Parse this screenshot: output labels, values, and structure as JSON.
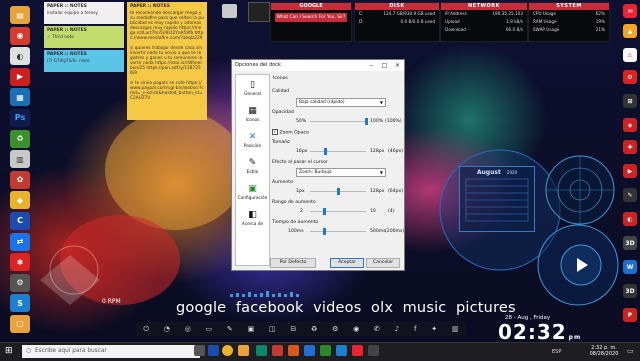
{
  "notes": [
    {
      "title": "PAPER :: NOTES",
      "text": "instalar equipo a teresy"
    },
    {
      "title": "PAPER :: NOTES",
      "text": "✓ Third note"
    },
    {
      "title": "PAPER :: NOTES",
      "text": "i7i G7#g7&%- nlare"
    },
    {
      "title": "PAPER :: NOTES",
      "text": "te recomiendo descargar mega y su mediafire para que salten la publicidad es muy rapido y ademas descargas muy rapido https://mega.nz/Lurt7hn5U9Lt2YnA59fb https://www.mediafire.com/?abqlz229\n\nsi quieres trabajar desde casa sin invertir nada tu envio a que te registres y ganes u tu remuneres invertir nada https://ezoi.io/cWheeibon/25 https://pan.adf.ly/1187256/9\n\nsi te sirvio pagale se cafe https://www.paypal.com/cgi-bin/webscr?cmd=_s-xclick&hosted_button_id=C2AUZ7V"
    }
  ],
  "top": {
    "google": {
      "title": "GOOGLE",
      "query": "What Can I Search For You, Sir?"
    },
    "disk": {
      "title": "DISK",
      "rows": [
        {
          "label": "C:",
          "value": "124.7 GB/930.9 GB used"
        },
        {
          "label": "D:",
          "value": "0.0 B/0.0 B used"
        }
      ]
    },
    "network": {
      "title": "NETWORK",
      "rows": [
        {
          "label": "IP Address",
          "value": "190.35.25.103"
        },
        {
          "label": "Upload",
          "value": "1.9 kB/s"
        },
        {
          "label": "Download",
          "value": "66.0 B/s"
        }
      ]
    },
    "system": {
      "title": "SYSTEM",
      "rows": [
        {
          "label": "CPU Usage",
          "value": "62%"
        },
        {
          "label": "RAM Usage",
          "value": "19%"
        },
        {
          "label": "SWAP Usage",
          "value": "21%"
        }
      ]
    }
  },
  "dialog": {
    "title": "Opciones del dock",
    "sidebar": [
      "General",
      "Iconos",
      "Posición",
      "Estilo",
      "Configuración",
      "Acerca de"
    ],
    "section": "Iconos",
    "calidad_label": "Calidad",
    "calidad_value": "Baja calidad (rápido)",
    "opacidad_label": "Opacidad",
    "opacidad_min": "50%",
    "opacidad_max": "100%",
    "opacidad_value": "(100%)",
    "opacidad_pos": 1.0,
    "zoom_opaco": "Zoom Opaco",
    "tamano_label": "Tamaño",
    "tamano_min": "16px",
    "tamano_max": "128px",
    "tamano_value": "(46px)",
    "tamano_pos": 0.27,
    "efecto_label": "Efecto al pasar el cursor",
    "efecto_value": "Zoom: Burbuja",
    "aumento_label": "Aumento",
    "aumento_min": "1px",
    "aumento_max": "128px",
    "aumento_value": "(64px)",
    "aumento_pos": 0.5,
    "rango_label": "Rango de aumento",
    "rango_min": "2",
    "rango_max": "10",
    "rango_value": "(4)",
    "rango_pos": 0.25,
    "tiempo_label": "Tiempo de aumento",
    "tiempo_min": "100ms",
    "tiempo_max": "500ms",
    "tiempo_value": "(200ms)",
    "tiempo_pos": 0.25,
    "btn_default": "Por Defecto",
    "btn_ok": "Aceptar",
    "btn_cancel": "Cancelar"
  },
  "words": [
    "google",
    "facebook",
    "videos",
    "olx",
    "music",
    "pictures"
  ],
  "fan": {
    "speed": "0",
    "unit": "RPM"
  },
  "clock": {
    "date": "28 - Aug , Friday",
    "time": "02:32",
    "ampm": "pm"
  },
  "calendar": {
    "month": "August",
    "year": "2020"
  },
  "taskbar": {
    "search_placeholder": "Escribe aquí para buscar",
    "time": "2:32 p. m.",
    "date": "08/28/2020",
    "lang": "ESP"
  },
  "colors": {
    "accent": "#c62c3a",
    "note_yellow": "#f6c945",
    "note_cyan": "#5ac5e6",
    "note_green": "#c3dc6e"
  }
}
